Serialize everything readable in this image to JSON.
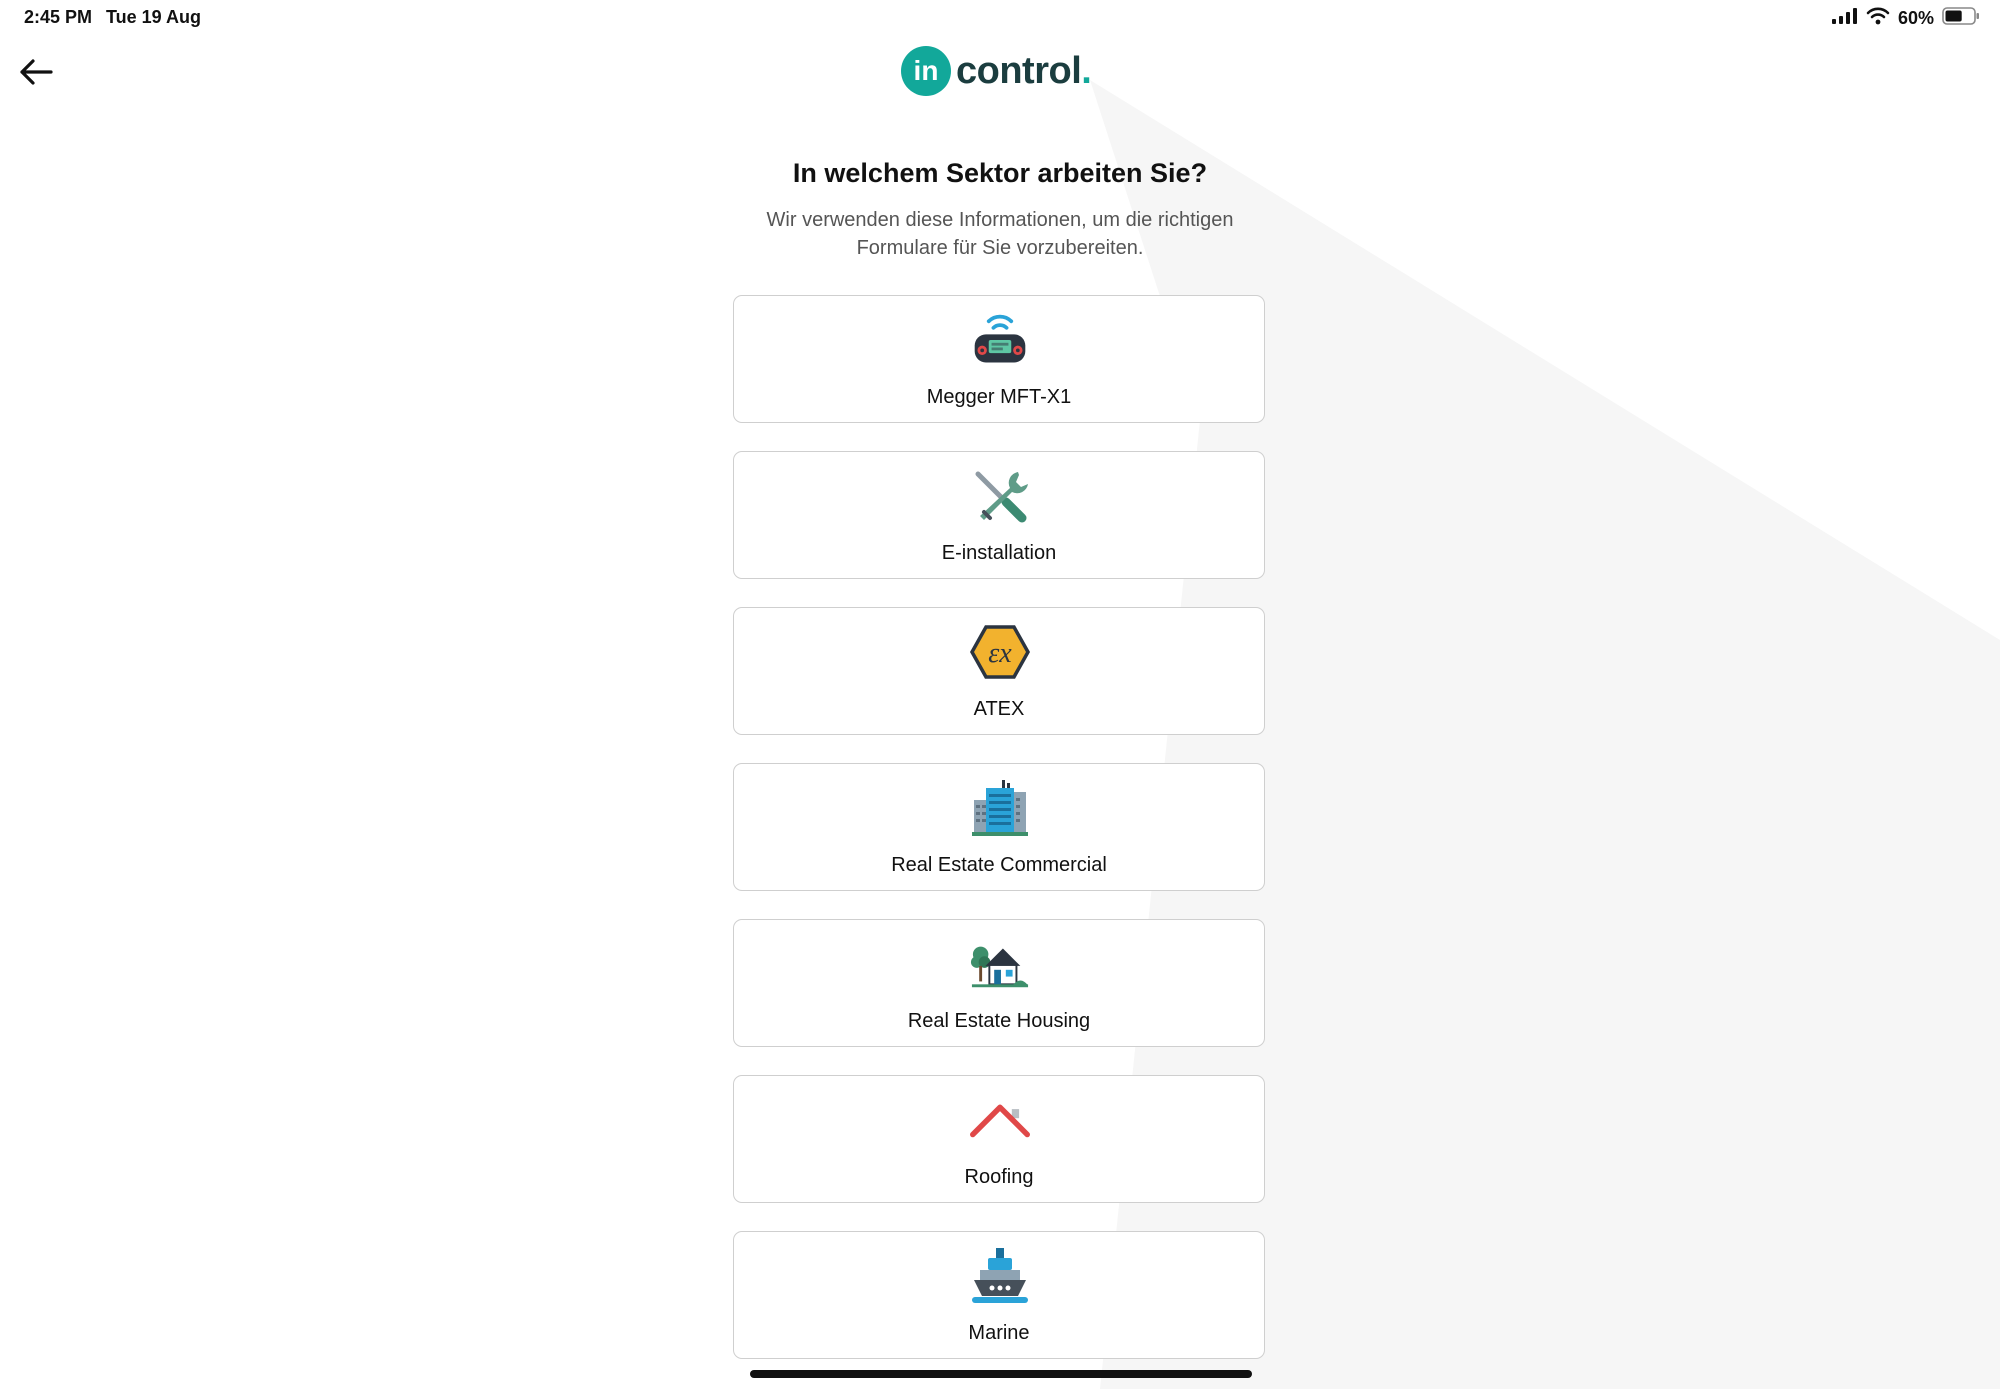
{
  "status_bar": {
    "time": "2:45 PM",
    "date": "Tue 19 Aug",
    "battery_percent": "60%",
    "battery_level": 0.6
  },
  "header": {
    "back_icon": "arrow-left-icon",
    "logo_mark": "in",
    "logo_text": "control",
    "logo_dot": "."
  },
  "colors": {
    "brand_teal": "#12a89a",
    "brand_dark": "#1b3d3f",
    "card_border": "#cfcfcf",
    "background_shape": "#f6f6f6"
  },
  "page": {
    "title": "In welchem Sektor arbeiten Sie?",
    "subtitle": "Wir verwenden diese Informationen, um die richtigen Formulare für Sie vorzubereiten."
  },
  "sectors": [
    {
      "label": "Megger MFT-X1",
      "icon": "tester-device-icon"
    },
    {
      "label": "E-installation",
      "icon": "wrench-screwdriver-icon"
    },
    {
      "label": "ATEX",
      "icon": "atex-ex-icon"
    },
    {
      "label": "Real Estate Commercial",
      "icon": "office-building-icon"
    },
    {
      "label": "Real Estate Housing",
      "icon": "house-icon"
    },
    {
      "label": "Roofing",
      "icon": "roof-icon"
    },
    {
      "label": "Marine",
      "icon": "ship-icon"
    }
  ]
}
